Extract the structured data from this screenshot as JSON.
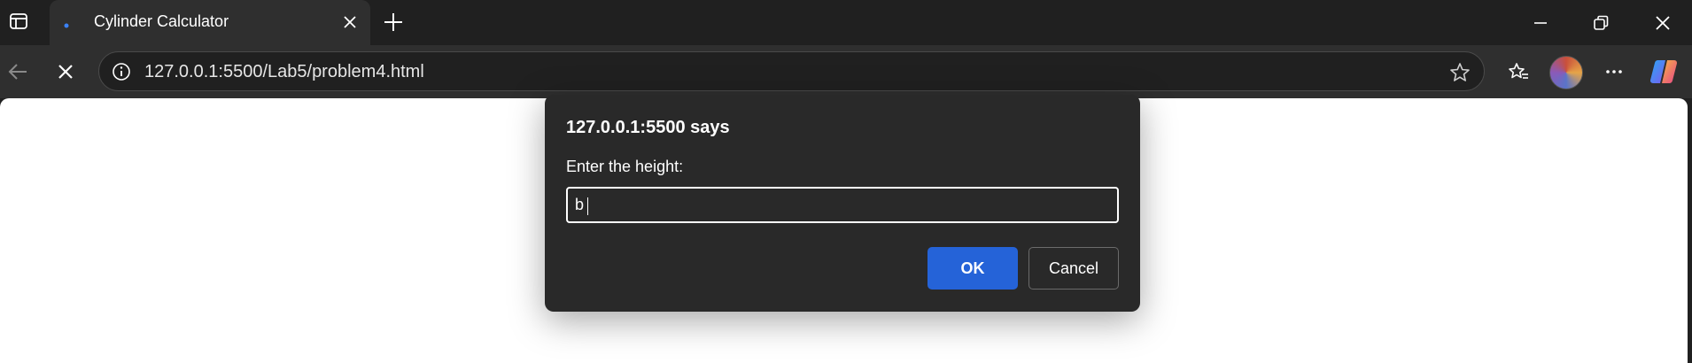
{
  "browser": {
    "tab": {
      "title": "Cylinder Calculator",
      "favicon": "loading-dot-icon"
    },
    "address_bar": {
      "url": "127.0.0.1:5500/Lab5/problem4.html"
    },
    "icons": {
      "sidebar": "sidebar-toggle-icon",
      "close_tab": "close-icon",
      "new_tab": "plus-icon",
      "minimize": "minimize-icon",
      "restore": "restore-icon",
      "close_window": "close-icon",
      "back": "back-arrow-icon",
      "stop": "stop-icon",
      "site_info": "info-icon",
      "favorite": "star-icon",
      "favorites": "favorites-icon",
      "profile": "avatar",
      "more": "more-icon",
      "copilot": "copilot-icon"
    }
  },
  "dialog": {
    "title": "127.0.0.1:5500 says",
    "message": "Enter the height:",
    "input_value": "b",
    "ok_label": "OK",
    "cancel_label": "Cancel"
  },
  "colors": {
    "chrome_dark": "#202020",
    "toolbar": "#2f2f2f",
    "dialog_bg": "#292929",
    "ok_button": "#2563d8",
    "page_bg": "#ffffff"
  }
}
